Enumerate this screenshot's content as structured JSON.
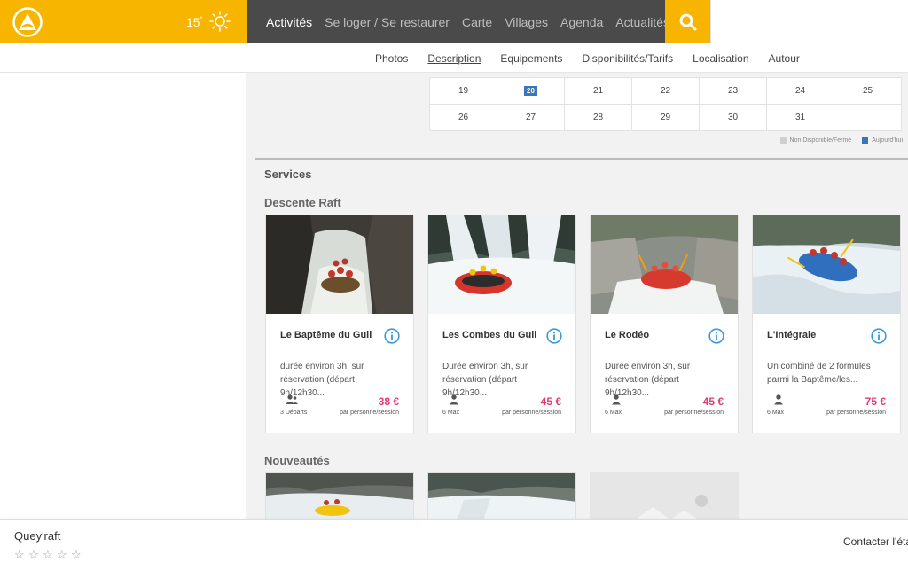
{
  "header": {
    "weather_temp": "15",
    "weather_unit": "°",
    "nav": [
      "Activités",
      "Se loger / Se restaurer",
      "Carte",
      "Villages",
      "Agenda",
      "Actualités"
    ],
    "active_nav": 0,
    "brand_color": "#f7b500"
  },
  "subnav": {
    "items": [
      "Photos",
      "Description",
      "Equipements",
      "Disponibilités/Tarifs",
      "Localisation",
      "Autour"
    ],
    "active": 1
  },
  "calendar": {
    "rows": [
      [
        "19",
        "20",
        "21",
        "22",
        "23",
        "24",
        "25"
      ],
      [
        "26",
        "27",
        "28",
        "29",
        "30",
        "31",
        ""
      ]
    ],
    "today": "20",
    "legend_unavailable": "Non Disponible/Fermé",
    "legend_today": "Aujourd'hui",
    "unavailable_color": "#cfcfcf",
    "today_color": "#3a74b9"
  },
  "services": {
    "title": "Services",
    "section_title": "Descente Raft",
    "cards": [
      {
        "title": "Le Baptême du Guil",
        "desc_line1": "durée environ 3h, sur",
        "desc_line2": "réservation (départ 9h/12h30...",
        "meta": "3 Départs",
        "price": "38 €",
        "unit": "par personne/session"
      },
      {
        "title": "Les Combes du Guil",
        "desc_line1": "Durée environ 3h, sur",
        "desc_line2": "réservation (départ 9h/12h30...",
        "meta": "6 Max",
        "price": "45 €",
        "unit": "par personne/session"
      },
      {
        "title": "Le Rodéo",
        "desc_line1": "Durée environ 3h, sur",
        "desc_line2": "réservation (départ 9h/12h30...",
        "meta": "6 Max",
        "price": "45 €",
        "unit": "par personne/session"
      },
      {
        "title": "L'Intégrale",
        "desc_line1": "Un combiné de 2 formules",
        "desc_line2": "parmi la Baptême/les...",
        "meta": "6 Max",
        "price": "75 €",
        "unit": "par personne/session"
      }
    ]
  },
  "news": {
    "title": "Nouveautés"
  },
  "bottom": {
    "name": "Quey'raft",
    "contact": "Contacter l'éta"
  }
}
